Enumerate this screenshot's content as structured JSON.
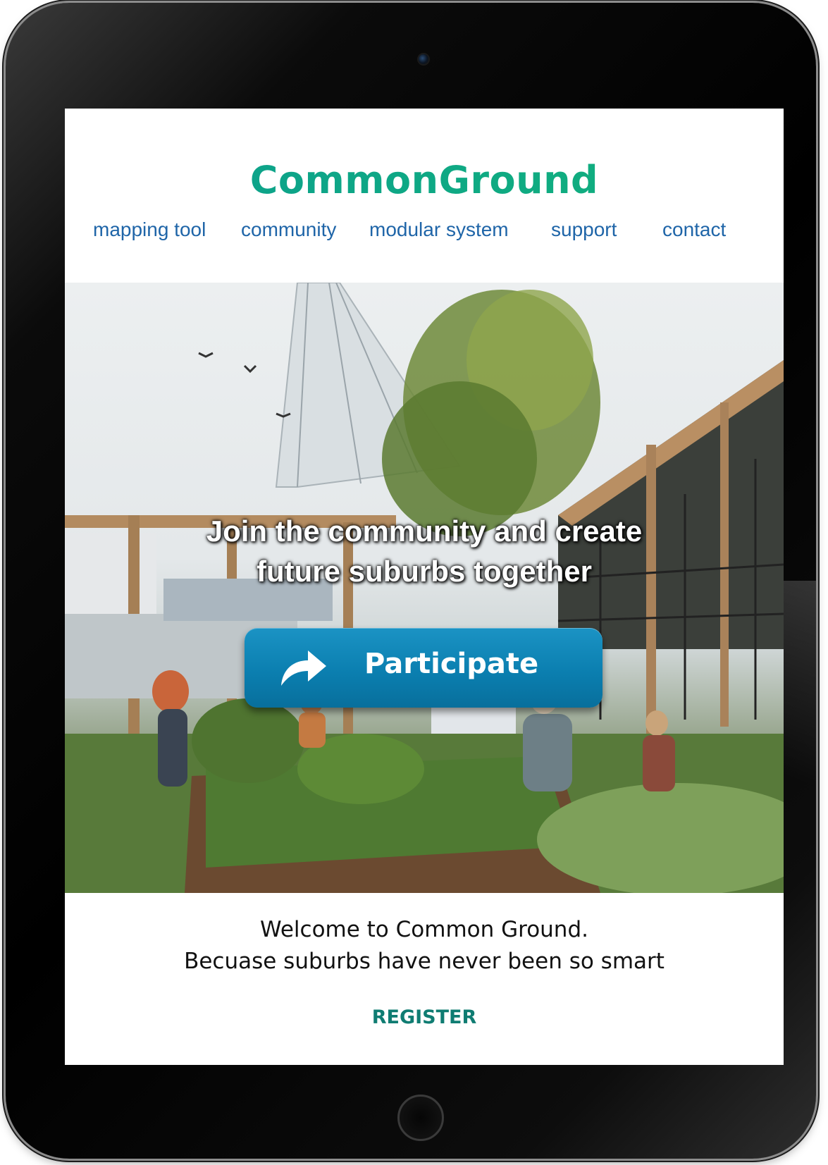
{
  "brand": {
    "name": "CommonGround",
    "color_start": "#0b9e8f",
    "color_end": "#12b27a"
  },
  "nav": {
    "items": [
      {
        "label": "mapping tool"
      },
      {
        "label": "community"
      },
      {
        "label": "modular system"
      },
      {
        "label": "support"
      },
      {
        "label": "contact"
      }
    ],
    "color": "#1f65a8"
  },
  "hero": {
    "headline_line1": "Join the community and create",
    "headline_line2": "future suburbs together",
    "cta": {
      "label": "Participate",
      "icon": "share-arrow-icon",
      "color": "#0b7fb0"
    }
  },
  "welcome": {
    "line1": "Welcome to Common Ground.",
    "line2": "Becuase suburbs have never been so smart"
  },
  "register": {
    "label": "REGISTER",
    "color": "#0f7c72"
  }
}
